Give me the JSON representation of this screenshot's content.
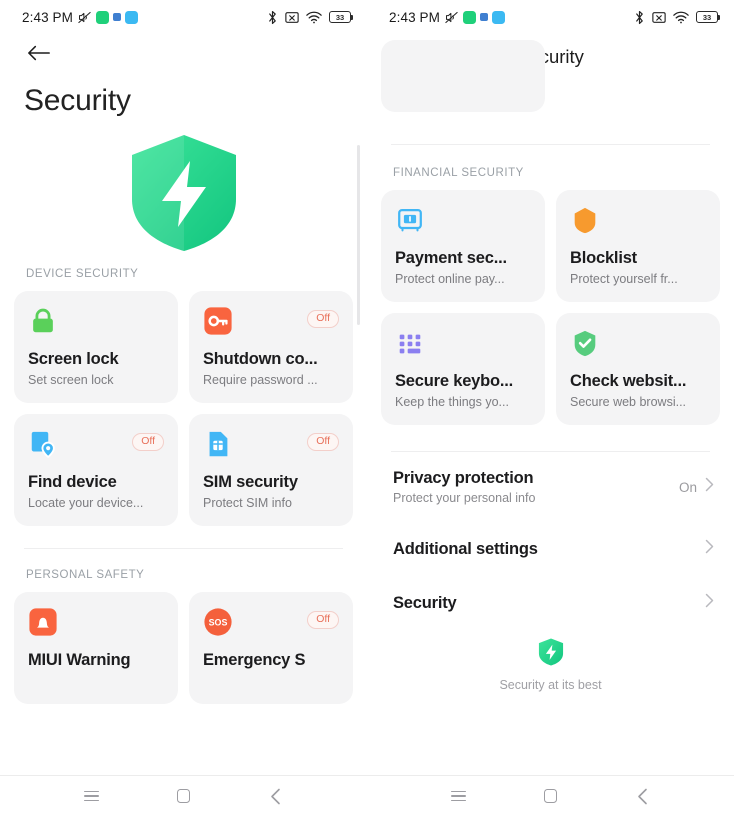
{
  "statusbar": {
    "time": "2:43 PM",
    "left_icons": [
      "volume-mute-icon",
      "app-green-icon",
      "dot-blue-icon",
      "app-blue-icon"
    ],
    "right_icons": [
      "bluetooth-icon",
      "sim-off-icon",
      "wifi-icon",
      "battery-icon"
    ],
    "battery_level": "33"
  },
  "left_panel": {
    "back": "back-arrow-icon",
    "title": "Security",
    "hero_icon": "shield-bolt-icon",
    "sections": [
      {
        "label": "DEVICE SECURITY",
        "cards": [
          {
            "icon": "padlock-icon",
            "title": "Screen lock",
            "subtitle": "Set screen lock",
            "badge": ""
          },
          {
            "icon": "key-icon",
            "title": "Shutdown co...",
            "subtitle": "Require password ...",
            "badge": "Off"
          },
          {
            "icon": "find-device-icon",
            "title": "Find device",
            "subtitle": "Locate your device...",
            "badge": "Off"
          },
          {
            "icon": "sim-card-icon",
            "title": "SIM security",
            "subtitle": "Protect SIM info",
            "badge": "Off"
          }
        ]
      },
      {
        "label": "PERSONAL SAFETY",
        "cards": [
          {
            "icon": "bell-warning-icon",
            "title": "MIUI Warning",
            "subtitle": "",
            "badge": ""
          },
          {
            "icon": "sos-icon",
            "title": "Emergency S",
            "subtitle": "",
            "badge": "Off"
          }
        ]
      }
    ]
  },
  "right_panel": {
    "back": "back-arrow-icon",
    "title": "Security",
    "sections": [
      {
        "label": "FINANCIAL SECURITY",
        "cards": [
          {
            "icon": "payment-safe-icon",
            "title": "Payment sec...",
            "subtitle": "Protect online pay...",
            "badge": ""
          },
          {
            "icon": "blocklist-shield-icon",
            "title": "Blocklist",
            "subtitle": "Protect yourself fr...",
            "badge": ""
          },
          {
            "icon": "keyboard-dots-icon",
            "title": "Secure keybo...",
            "subtitle": "Keep the things yo...",
            "badge": ""
          },
          {
            "icon": "shield-check-icon",
            "title": "Check websit...",
            "subtitle": "Secure web browsi...",
            "badge": ""
          }
        ]
      }
    ],
    "rows": [
      {
        "title": "Privacy protection",
        "subtitle": "Protect your personal info",
        "value": "On",
        "chevron": "chevron-right-icon"
      },
      {
        "title": "Additional settings",
        "subtitle": "",
        "value": "",
        "chevron": "chevron-right-icon"
      },
      {
        "title": "Security",
        "subtitle": "",
        "value": "",
        "chevron": "chevron-right-icon"
      }
    ],
    "brand": {
      "icon": "shield-bolt-small-icon",
      "text": "Security at its best"
    }
  },
  "navbar": {
    "items": [
      "recents-icon",
      "home-icon",
      "back-icon"
    ]
  },
  "colors": {
    "accent_green": "#22d18a",
    "card_bg": "#f4f4f5",
    "badge_text": "#e8705a",
    "orange": "#f96a4b",
    "blue": "#41b6f5",
    "purple": "#8b7ff0"
  }
}
